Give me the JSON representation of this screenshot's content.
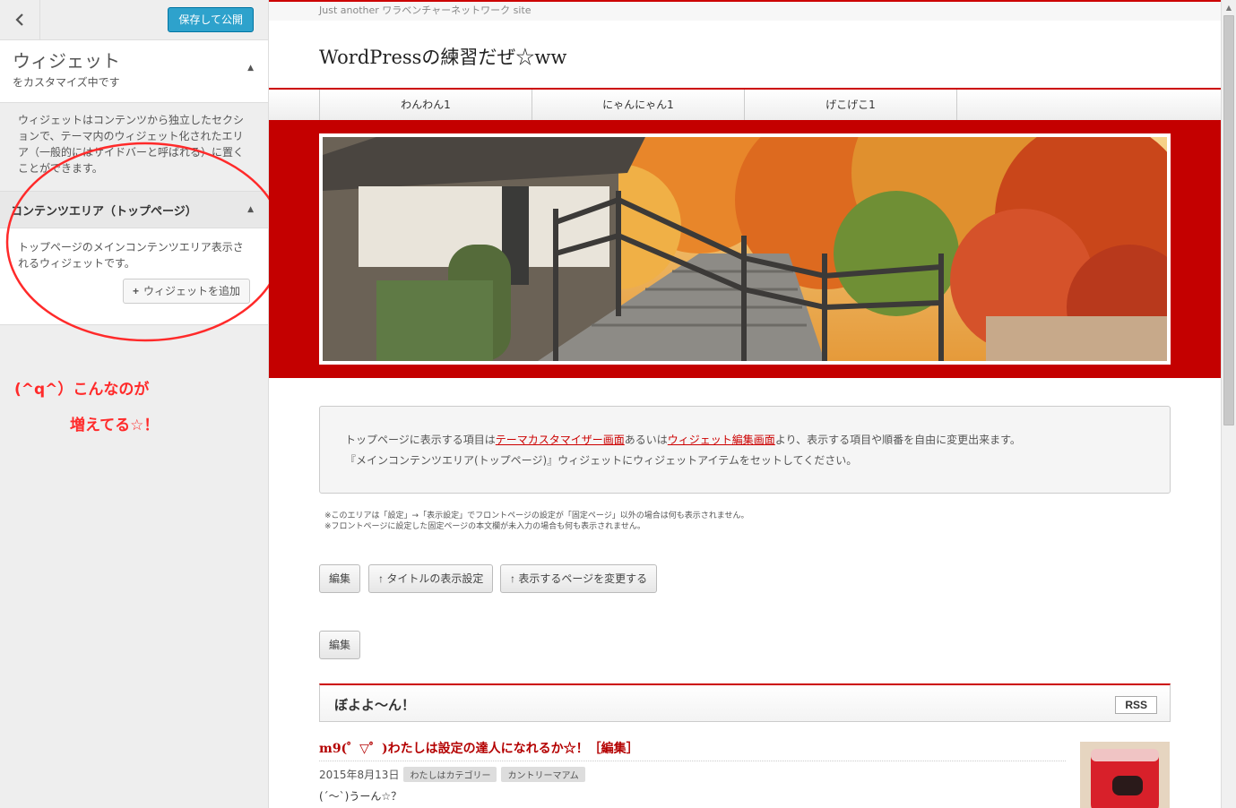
{
  "sidebar": {
    "back_icon": "chevron-left-icon",
    "publish_label": "保存して公開",
    "section_title": "ウィジェット",
    "section_subtitle": "をカスタマイズ中です",
    "section_description": "ウィジェットはコンテンツから独立したセクションで、テーマ内のウィジェット化されたエリア（一般的にはサイドバーと呼ばれる）に置くことができます。",
    "area_title": "コンテンツエリア（トップページ）",
    "area_description": "トップページのメインコンテンツエリア表示されるウィジェットです。",
    "add_widget_label": "ウィジェットを追加",
    "collapse_glyph": "▲",
    "annotation_line1": "(^q^）こんなのが",
    "annotation_line2": "増えてる☆！",
    "annotation_color": "#ff2a2a"
  },
  "preview": {
    "tagline": "Just another ワラベンチャーネットワーク site",
    "site_title": "WordPressの練習だぜ☆ww",
    "menu": [
      "わんわん1",
      "にゃんにゃん1",
      "げこげこ1"
    ],
    "info_text_1": "トップページに表示する項目は",
    "info_link_1": "テーマカスタマイザー画面",
    "info_text_2": "あるいは",
    "info_link_2": "ウィジェット編集画面",
    "info_text_3": "より、表示する項目や順番を自由に変更出来ます。",
    "info_text_4": "『メインコンテンツエリア(トップページ)』ウィジェットにウィジェットアイテムをセットしてください。",
    "note_1": "※このエリアは「設定」→「表示設定」でフロントページの設定が「固定ページ」以外の場合は何も表示されません。",
    "note_2": "※フロントページに設定した固定ページの本文欄が未入力の場合も何も表示されません。",
    "edit_label": "編集",
    "title_setting_label": "↑ タイトルの表示設定",
    "change_page_label": "↑ 表示するページを変更する",
    "edit_label_2": "編集",
    "widget_title": "ぼよよ〜ん！",
    "rss_label": "RSS",
    "post_title": "m9(゜▽゜)わたしは設定の達人になれるか☆！［編集］",
    "post_date": "2015年8月13日",
    "post_tags": [
      "わたしはカテゴリー",
      "カントリーマアム"
    ],
    "post_excerpt": "(´～`)うーん☆？",
    "accent_color": "#c00000"
  }
}
